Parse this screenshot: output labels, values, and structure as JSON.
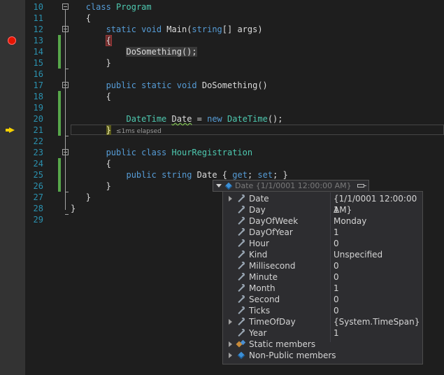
{
  "line_numbers": [
    "10",
    "11",
    "12",
    "13",
    "14",
    "15",
    "16",
    "17",
    "18",
    "19",
    "20",
    "21",
    "22",
    "23",
    "24",
    "25",
    "26",
    "27",
    "28",
    "29"
  ],
  "code": {
    "l10": {
      "kw": "class",
      "name": "Program"
    },
    "l11": "{",
    "l12": {
      "kw": "static void",
      "name": "Main(",
      "type": "string",
      "rest": "[] args)"
    },
    "l13": "{",
    "l14": "DoSomething();",
    "l15": "}",
    "l17": {
      "kw": "public static void",
      "name": "DoSomething()"
    },
    "l18": "{",
    "l20": {
      "type": "DateTime",
      "var": "Date",
      "eq": " = ",
      "kw": "new",
      "type2": "DateTime",
      "rest": "();"
    },
    "l21": {
      "brace": "}",
      "elapsed": "≤1ms elapsed"
    },
    "l23": {
      "kw": "public class",
      "name": "HourRegistration"
    },
    "l24": "{",
    "l25": {
      "kw": "public",
      "type": "string",
      "name": "Date { ",
      "get": "get",
      "sep": "; ",
      "set": "set",
      "end": "; }"
    },
    "l26": "}",
    "l27": "}",
    "l28": "}"
  },
  "datatip": {
    "header_name": "Date",
    "header_value": "{1/1/0001 12:00:00 AM}",
    "rows": [
      {
        "name": "Date",
        "value": "{1/1/0001 12:00:00 AM}",
        "icon": "wrench-icon",
        "expandable": true
      },
      {
        "name": "Day",
        "value": "1",
        "icon": "wrench-icon",
        "expandable": false
      },
      {
        "name": "DayOfWeek",
        "value": "Monday",
        "icon": "wrench-icon",
        "expandable": false
      },
      {
        "name": "DayOfYear",
        "value": "1",
        "icon": "wrench-icon",
        "expandable": false
      },
      {
        "name": "Hour",
        "value": "0",
        "icon": "wrench-icon",
        "expandable": false
      },
      {
        "name": "Kind",
        "value": "Unspecified",
        "icon": "wrench-icon",
        "expandable": false
      },
      {
        "name": "Millisecond",
        "value": "0",
        "icon": "wrench-icon",
        "expandable": false
      },
      {
        "name": "Minute",
        "value": "0",
        "icon": "wrench-icon",
        "expandable": false
      },
      {
        "name": "Month",
        "value": "1",
        "icon": "wrench-icon",
        "expandable": false
      },
      {
        "name": "Second",
        "value": "0",
        "icon": "wrench-icon",
        "expandable": false
      },
      {
        "name": "Ticks",
        "value": "0",
        "icon": "wrench-icon",
        "expandable": false
      },
      {
        "name": "TimeOfDay",
        "value": "{System.TimeSpan}",
        "icon": "wrench-icon",
        "expandable": true
      },
      {
        "name": "Year",
        "value": "1",
        "icon": "wrench-icon",
        "expandable": false
      },
      {
        "name": "Static members",
        "value": "",
        "icon": "static-members-icon",
        "expandable": true
      },
      {
        "name": "Non-Public members",
        "value": "",
        "icon": "class-cube-icon",
        "expandable": true
      }
    ]
  },
  "colors": {
    "background": "#1e1e1e",
    "keyword": "#569cd6",
    "type": "#4ec9b0",
    "line_number": "#2b91af",
    "breakpoint": "#e51400",
    "current_statement_arrow": "#f5d000",
    "change_bar": "#57a64a"
  }
}
